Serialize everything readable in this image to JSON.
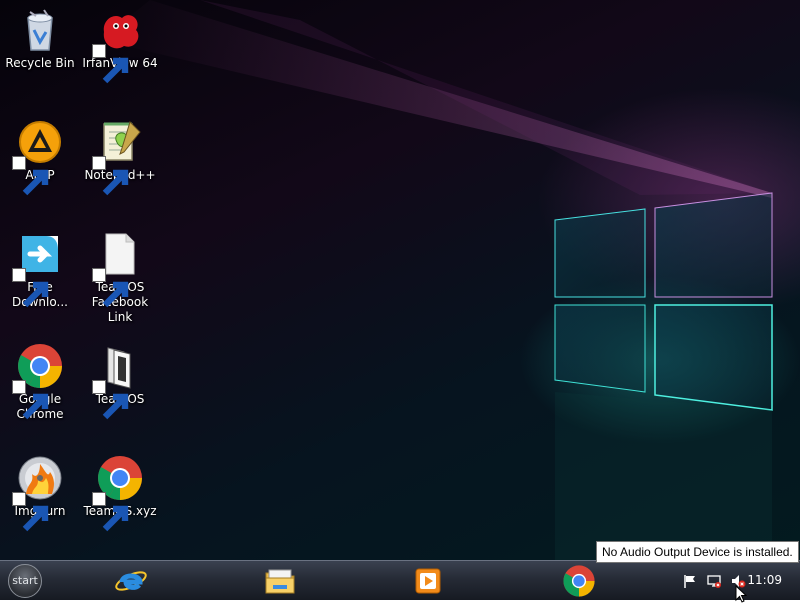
{
  "desktop": {
    "icons": [
      {
        "label": "Recycle Bin",
        "icon": "recycle-bin-icon"
      },
      {
        "label": "IrfanView 64",
        "icon": "irfanview-icon"
      },
      {
        "label": "AIMP",
        "icon": "aimp-icon"
      },
      {
        "label": "Notepad++",
        "icon": "notepadpp-icon"
      },
      {
        "label": "Free Downlo...",
        "icon": "free-download-manager-icon"
      },
      {
        "label": "TeamOS Facebook Link",
        "icon": "blank-document-icon"
      },
      {
        "label": "Google Chrome",
        "icon": "chrome-icon"
      },
      {
        "label": "TeamOS",
        "icon": "file-icon"
      },
      {
        "label": "ImgBurn",
        "icon": "imgburn-icon"
      },
      {
        "label": "TeamOS.xyz",
        "icon": "chrome-icon"
      }
    ]
  },
  "taskbar": {
    "start_label": "start",
    "apps": [
      "internet-explorer-icon",
      "file-explorer-icon",
      "media-player-icon",
      "chrome-icon"
    ],
    "tray": [
      "flag-icon",
      "network-icon",
      "speaker-muted-icon"
    ],
    "clock": "11:09"
  },
  "tooltip": {
    "text": "No Audio Output Device is installed."
  },
  "colors": {
    "taskbar_top": "#3a4150",
    "taskbar_bottom": "#161a22",
    "window_glow": "#2fd6d0",
    "light_streak": "#c04fb0"
  }
}
